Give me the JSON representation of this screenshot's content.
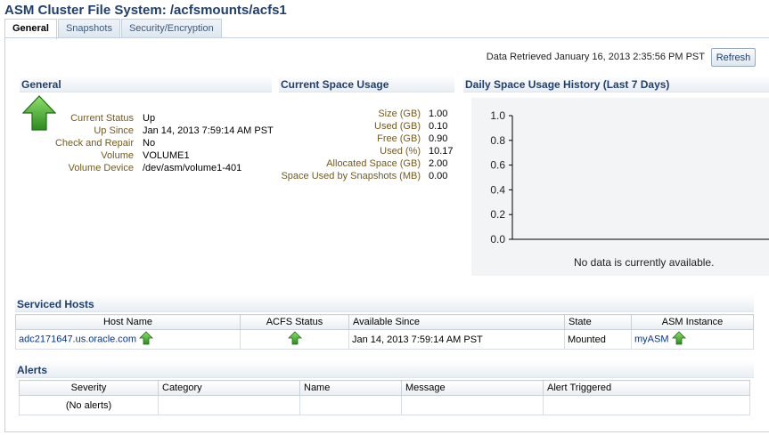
{
  "page": {
    "title": "ASM Cluster File System: /acfsmounts/acfs1"
  },
  "tabs": [
    {
      "label": "General",
      "active": true
    },
    {
      "label": "Snapshots",
      "active": false
    },
    {
      "label": "Security/Encryption",
      "active": false
    }
  ],
  "toolbar": {
    "retrieved": "Data Retrieved January 16, 2013 2:35:56 PM PST",
    "refresh_label": "Refresh"
  },
  "general": {
    "heading": "General",
    "status_icon": "up-arrow-icon",
    "fields": [
      {
        "label": "Current Status",
        "value": "Up"
      },
      {
        "label": "Up Since",
        "value": "Jan 14, 2013 7:59:14 AM PST"
      },
      {
        "label": "Check and Repair",
        "value": "No"
      },
      {
        "label": "Volume",
        "value": "VOLUME1"
      },
      {
        "label": "Volume Device",
        "value": "/dev/asm/volume1-401"
      }
    ]
  },
  "space": {
    "heading": "Current Space Usage",
    "fields": [
      {
        "label": "Size (GB)",
        "value": "1.00"
      },
      {
        "label": "Used (GB)",
        "value": "0.10"
      },
      {
        "label": "Free (GB)",
        "value": "0.90"
      },
      {
        "label": "Used (%)",
        "value": "10.17"
      },
      {
        "label": "Allocated Space (GB)",
        "value": "2.00"
      },
      {
        "label": "Space Used by Snapshots (MB)",
        "value": "0.00"
      }
    ]
  },
  "history": {
    "heading": "Daily Space Usage History (Last 7 Days)",
    "no_data": "No data is currently available."
  },
  "chart_data": {
    "type": "line",
    "title": "Daily Space Usage History (Last 7 Days)",
    "series": [],
    "y_ticks": [
      "1.0",
      "0.8",
      "0.6",
      "0.4",
      "0.2",
      "0.0"
    ],
    "ylim": [
      0,
      1
    ],
    "grid": false
  },
  "hosts": {
    "heading": "Serviced Hosts",
    "columns": [
      "Host Name",
      "ACFS Status",
      "Available Since",
      "State",
      "ASM Instance"
    ],
    "rows": [
      {
        "host": "adc2171647.us.oracle.com",
        "available_since": "Jan 14, 2013 7:59:14 AM PST",
        "state": "Mounted",
        "asm_instance": "myASM"
      }
    ]
  },
  "alerts": {
    "heading": "Alerts",
    "columns": [
      "Severity",
      "Category",
      "Name",
      "Message",
      "Alert Triggered"
    ],
    "empty": "(No alerts)"
  },
  "colors": {
    "title": "#1f3f6e",
    "label": "#735b1e",
    "link": "#003399",
    "up_green": "#3a9a2c"
  }
}
